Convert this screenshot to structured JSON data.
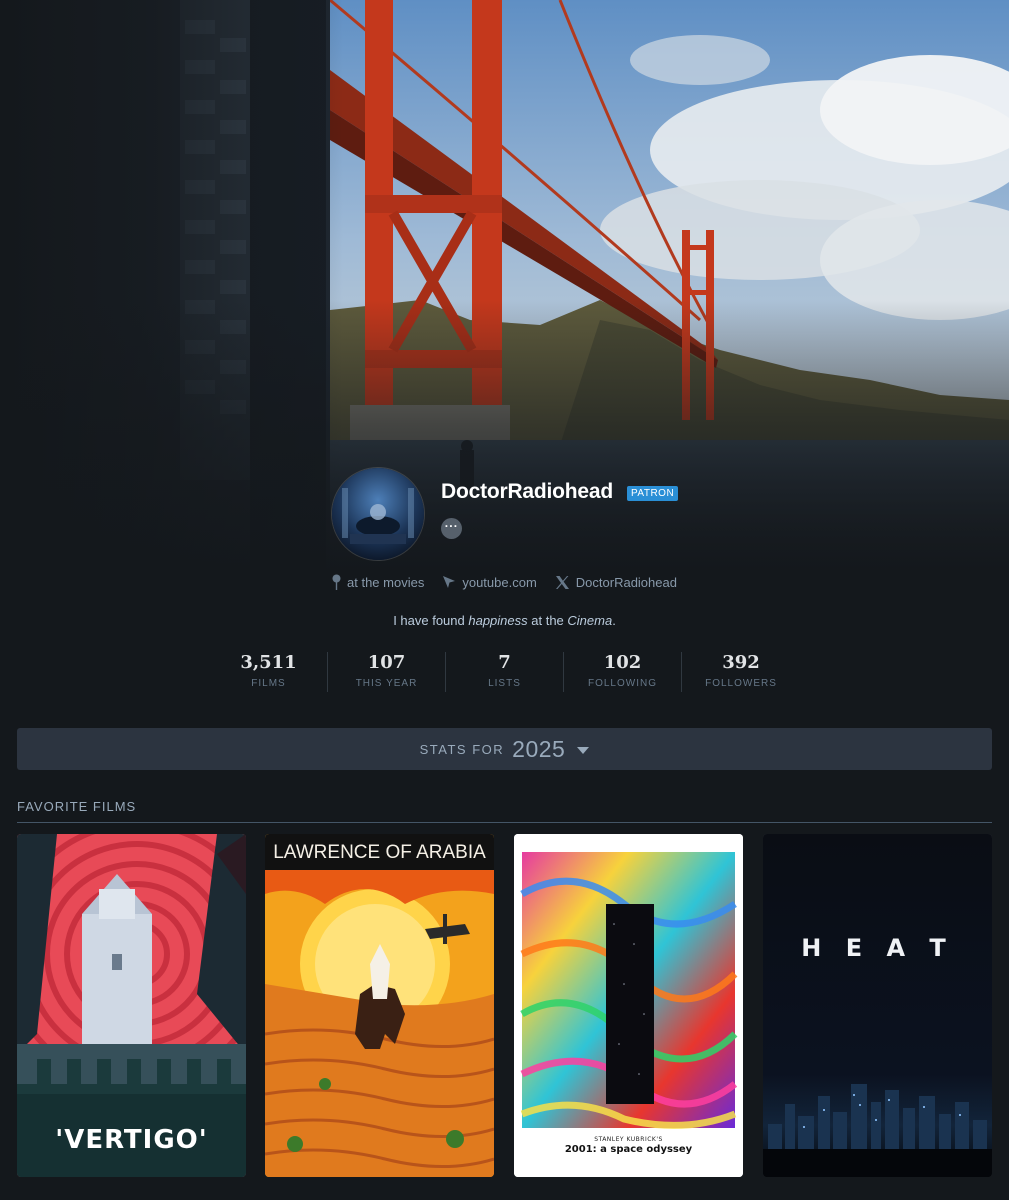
{
  "profile": {
    "username": "DoctorRadiohead",
    "badge": "PATRON",
    "more_label": "···",
    "location": "at the movies",
    "website": "youtube.com",
    "twitter": "DoctorRadiohead",
    "bio": {
      "pre": "I have found ",
      "em1": "happiness",
      "mid": " at the ",
      "em2": "Cinema",
      "post": "."
    }
  },
  "stats": [
    {
      "value": "3,511",
      "label": "FILMS"
    },
    {
      "value": "107",
      "label": "THIS YEAR"
    },
    {
      "value": "7",
      "label": "LISTS"
    },
    {
      "value": "102",
      "label": "FOLLOWING"
    },
    {
      "value": "392",
      "label": "FOLLOWERS"
    }
  ],
  "stats_bar": {
    "label": "STATS FOR",
    "year": "2025"
  },
  "favorites": {
    "heading": "FAVORITE FILMS",
    "films": [
      {
        "poster_text": "'VERTIGO'"
      },
      {
        "poster_text": "LAWRENCE OF ARABIA"
      },
      {
        "poster_text": "2001: a space odyssey",
        "poster_subtext": "STANLEY KUBRICK'S"
      },
      {
        "poster_text": "H E A T"
      }
    ]
  },
  "colors": {
    "background": "#14181c",
    "badge": "#2a8fd6",
    "stats_bar": "#2c3440"
  },
  "icons": [
    "location-pin-icon",
    "link-cursor-icon",
    "x-logo-icon",
    "more-dots-icon",
    "caret-down-icon"
  ]
}
